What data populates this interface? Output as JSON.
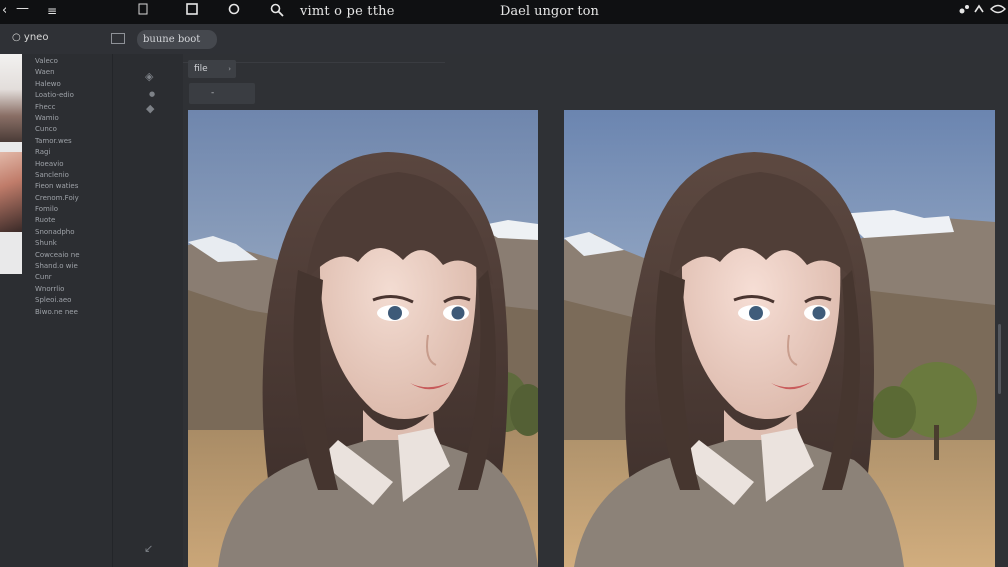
{
  "titlebar": {
    "title": "vimt o pe tthe",
    "document": "Dael ungor ton"
  },
  "toolbar": {
    "options_label": "yneo",
    "button_label": "buune boot"
  },
  "leftpanel": {
    "files": [
      "Valeco",
      "Waen",
      "Halewo",
      "Loatio-edio",
      "Fhecc",
      "Wamio",
      "Cunco",
      "Tamor.wes",
      "Ragi",
      "Hoeavio",
      "Sanclenio",
      "Fieon waties",
      "Crenom.Foiy",
      "Fomilo",
      "Ruote",
      "Snonadpho",
      "Shunk",
      "Cowceaio ne",
      "Shand.o wie",
      "Cunr",
      "Wnorrlio",
      "Spleoi.aeo",
      "Biwo.ne nee"
    ]
  },
  "canvas": {
    "file_field": "file",
    "sub_field": "-"
  }
}
